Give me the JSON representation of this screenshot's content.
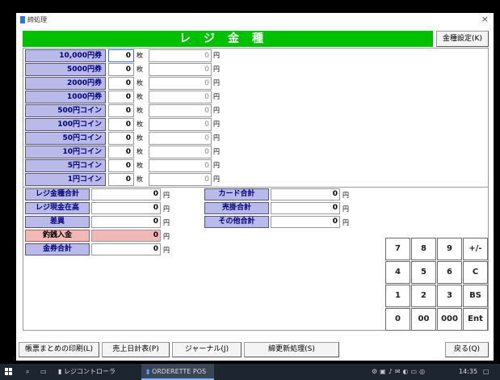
{
  "window": {
    "title": "締処理",
    "close_glyph": "×"
  },
  "header": {
    "title": "レジ金種",
    "settings_button": "金種設定(K)"
  },
  "denominations": [
    {
      "label": "10,000円券",
      "count": "0",
      "amount": "0"
    },
    {
      "label": "5000円券",
      "count": "0",
      "amount": "0"
    },
    {
      "label": "2000円券",
      "count": "0",
      "amount": "0"
    },
    {
      "label": "1000円券",
      "count": "0",
      "amount": "0"
    },
    {
      "label": "500円コイン",
      "count": "0",
      "amount": "0"
    },
    {
      "label": "100円コイン",
      "count": "0",
      "amount": "0"
    },
    {
      "label": "50円コイン",
      "count": "0",
      "amount": "0"
    },
    {
      "label": "10円コイン",
      "count": "0",
      "amount": "0"
    },
    {
      "label": "5円コイン",
      "count": "0",
      "amount": "0"
    },
    {
      "label": "1円コイン",
      "count": "0",
      "amount": "0"
    }
  ],
  "units": {
    "mai": "枚",
    "yen": "円"
  },
  "totals_left": [
    {
      "label": "レジ金種合計",
      "value": "0"
    },
    {
      "label": "レジ現金在高",
      "value": "0"
    },
    {
      "label": "差異",
      "value": "0"
    },
    {
      "label": "釣銭入金",
      "value": "0"
    },
    {
      "label": "金券合計",
      "value": "0"
    }
  ],
  "totals_right": [
    {
      "label": "カード合計",
      "value": "0"
    },
    {
      "label": "売掛合計",
      "value": "0"
    },
    {
      "label": "その他合計",
      "value": "0"
    }
  ],
  "keypad": [
    "7",
    "8",
    "9",
    "+/-",
    "4",
    "5",
    "6",
    "C",
    "1",
    "2",
    "3",
    "BS",
    "0",
    "00",
    "000",
    "Ent"
  ],
  "footer": {
    "print_summary": "帳票まとめの印刷(L)",
    "daily_report": "売上日計表(P)",
    "journal": "ジャーナル(J)",
    "close_update": "締更新処理(S)",
    "back": "戻る(Q)"
  },
  "taskbar": {
    "app1": "レジコントローラ",
    "app2": "ORDERETTE POS",
    "time": "14:35"
  },
  "colors": {
    "header_green": "#00c000",
    "label_blue": "#b9b9ea",
    "highlight_pink": "#f2b7b7",
    "taskbar": "#1c2530"
  }
}
